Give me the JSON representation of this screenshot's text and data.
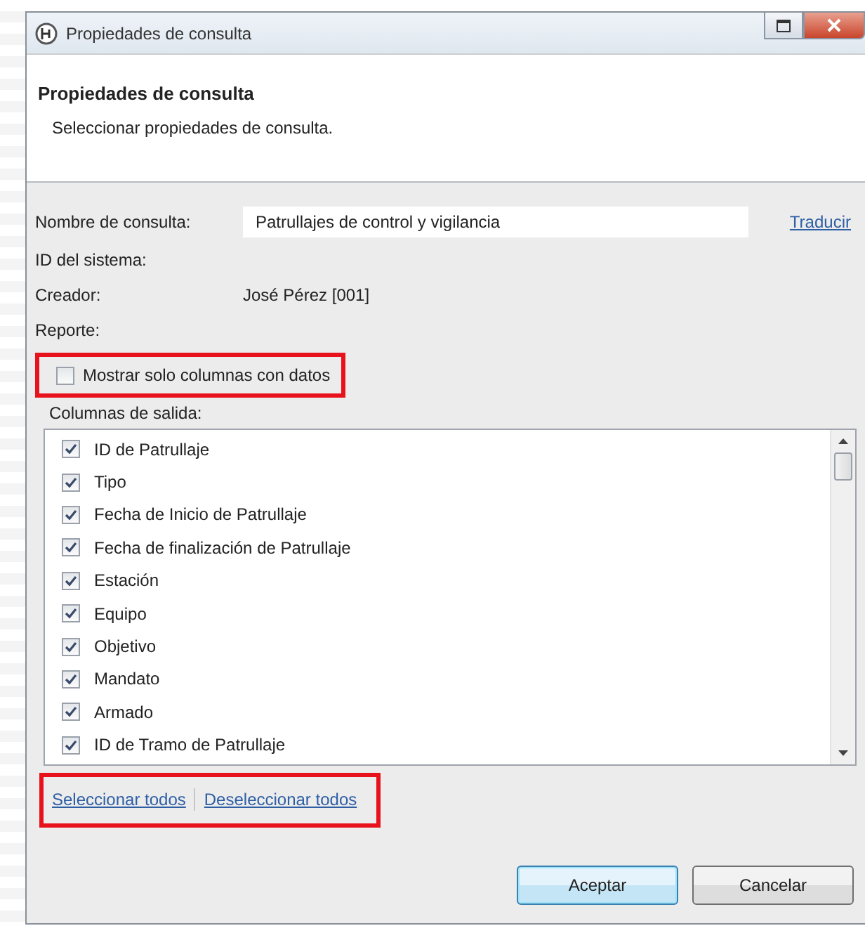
{
  "window": {
    "title": "Propiedades de consulta"
  },
  "header": {
    "title": "Propiedades de consulta",
    "subtitle": "Seleccionar propiedades de consulta."
  },
  "query_name": {
    "label": "Nombre de consulta:",
    "value": "Patrullajes de control y vigilancia",
    "translate_link": "Traducir"
  },
  "system_id": {
    "label": "ID del sistema:"
  },
  "creator": {
    "label": "Creador:",
    "value": "José Pérez [001]"
  },
  "report": {
    "label": "Reporte:"
  },
  "show_only_with_data": {
    "label": "Mostrar solo columnas con datos",
    "checked": false,
    "highlighted": true
  },
  "output_columns": {
    "label": "Columnas de salida:",
    "items": [
      {
        "label": "ID de Patrullaje",
        "checked": true
      },
      {
        "label": "Tipo",
        "checked": true
      },
      {
        "label": "Fecha de Inicio de Patrullaje",
        "checked": true
      },
      {
        "label": "Fecha de finalización de Patrullaje",
        "checked": true
      },
      {
        "label": "Estación",
        "checked": true
      },
      {
        "label": "Equipo",
        "checked": true
      },
      {
        "label": "Objetivo",
        "checked": true
      },
      {
        "label": "Mandato",
        "checked": true
      },
      {
        "label": "Armado",
        "checked": true
      },
      {
        "label": "ID de Tramo de Patrullaje",
        "checked": true
      }
    ]
  },
  "selection_links": {
    "highlighted": true,
    "links": [
      "Seleccionar todos",
      "Deseleccionar todos"
    ]
  },
  "buttons": [
    {
      "label": "Aceptar",
      "default": true
    },
    {
      "label": "Cancelar",
      "default": false
    }
  ]
}
